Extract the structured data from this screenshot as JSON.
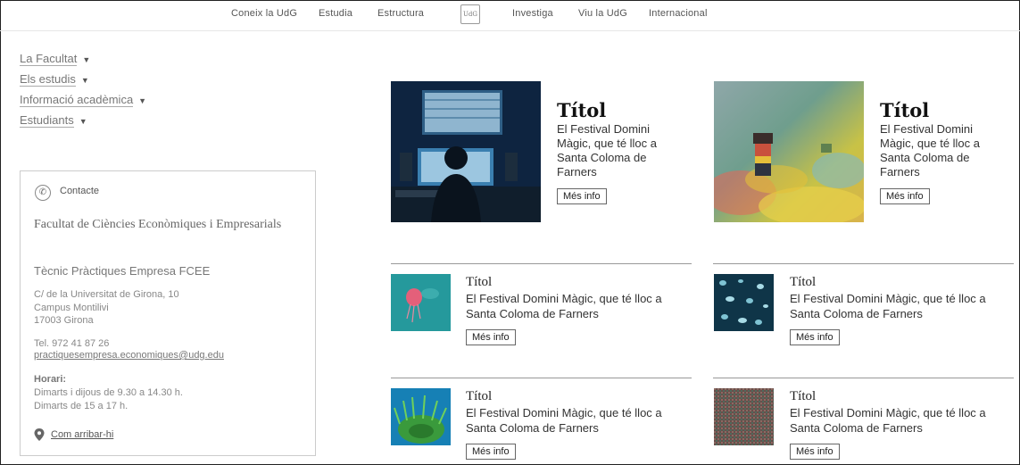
{
  "nav": {
    "items": [
      "Coneix la UdG",
      "Estudia",
      "Estructura",
      "Investiga",
      "Viu la UdG",
      "Internacional"
    ],
    "logo": "UdG"
  },
  "sidebar": {
    "items": [
      {
        "label": "La Facultat"
      },
      {
        "label": "Els estudis"
      },
      {
        "label": "Informació acadèmica"
      },
      {
        "label": "Estudiants"
      }
    ],
    "caret": "▼"
  },
  "contact": {
    "title": "Contacte",
    "faculty": "Facultat de Ciències Econòmiques i Empresarials",
    "unit": "Tècnic Pràctiques Empresa FCEE",
    "address_line1": "C/ de la Universitat de Girona, 10",
    "address_line2": "Campus Montilivi",
    "address_line3": "17003  Girona",
    "phone": "Tel. 972 41 87 26",
    "email": "practiquesempresa.economiques@udg.edu",
    "schedule_label": "Horari:",
    "schedule_line1": "Dimarts i dijous de 9.30 a 14.30 h.",
    "schedule_line2": "Dimarts de 15 a 17 h.",
    "directions": "Com arribar-hi"
  },
  "featured": [
    {
      "title": "Títol",
      "description": "El Festival Domini Màgic, que té lloc a Santa Coloma de Farners",
      "button": "Més info",
      "image": "studio"
    },
    {
      "title": "Títol",
      "description": "El Festival Domini Màgic, que té lloc a Santa Coloma de Farners",
      "button": "Més info",
      "image": "figurine"
    }
  ],
  "cards": [
    {
      "title": "Títol",
      "description": "El Festival Domini Màgic, que té lloc a Santa Coloma de Farners",
      "button": "Més info",
      "image": "jellyfish"
    },
    {
      "title": "Títol",
      "description": "El Festival Domini Màgic, que té lloc a Santa Coloma de Farners",
      "button": "Més info",
      "image": "jellyfish-swarm"
    },
    {
      "title": "Títol",
      "description": "El Festival Domini Màgic, que té lloc a Santa Coloma de Farners",
      "button": "Més info",
      "image": "sea-anemone"
    },
    {
      "title": "Títol",
      "description": "El Festival Domini Màgic, que té lloc a Santa Coloma de Farners",
      "button": "Més info",
      "image": "fabric-texture"
    }
  ]
}
